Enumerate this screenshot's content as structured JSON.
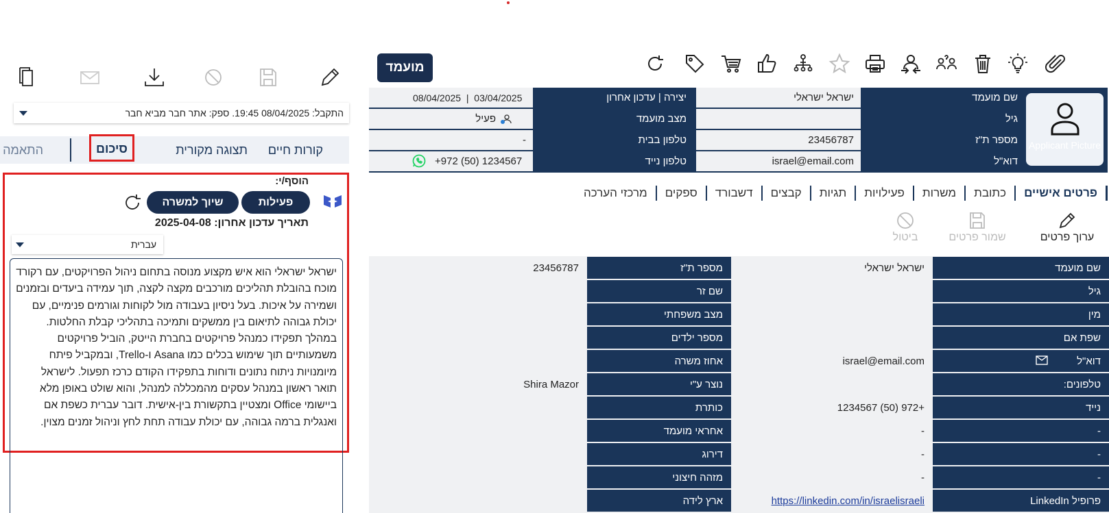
{
  "toolbar_right": {
    "brand_label": "מועמד",
    "icons": [
      "refresh-icon",
      "tag-icon",
      "cart-icon",
      "thumbs-up-icon",
      "org-chart-icon",
      "star-icon",
      "print-icon",
      "user-transfer-icon",
      "users-question-icon",
      "trash-icon",
      "lightbulb-icon",
      "paperclip-icon"
    ]
  },
  "header": {
    "avatar_text": "Applicant Picture",
    "rows": [
      {
        "label1": "שם מועמד",
        "value1": "ישראל ישראלי",
        "label2": "יצירה | עדכון אחרון",
        "value2a": "03/04/2025",
        "value2sep": "|",
        "value2b": "08/04/2025"
      },
      {
        "label1": "גיל",
        "value1": "",
        "label2": "מצב מועמד",
        "value2": "פעיל"
      },
      {
        "label1": "מספר ת\"ז",
        "value1": "23456787",
        "label2": "טלפון בבית",
        "value2": "-"
      },
      {
        "label1": "דוא\"ל",
        "value1": "israel@email.com",
        "label2": "טלפון נייד",
        "value2": "+972 (50) 1234567"
      }
    ]
  },
  "tabs": [
    "פרטים אישיים",
    "כתובת",
    "משרות",
    "פעילויות",
    "תגיות",
    "קבצים",
    "דשבורד",
    "ספקים",
    "מרכזי הערכה"
  ],
  "actions": {
    "edit": "ערוך פרטים",
    "save": "שמור פרטים",
    "cancel": "ביטול"
  },
  "details": [
    {
      "l1": "שם מועמד",
      "v1": "ישראל ישראלי",
      "l2": "מספר ת\"ז",
      "v2": "23456787"
    },
    {
      "l1": "גיל",
      "v1": "",
      "l2": "שם זר",
      "v2": ""
    },
    {
      "l1": "מין",
      "v1": "",
      "l2": "מצב משפחתי",
      "v2": ""
    },
    {
      "l1": "שפת אם",
      "v1": "",
      "l2": "מספר ילדים",
      "v2": ""
    },
    {
      "l1": "דוא\"ל",
      "v1": "israel@email.com",
      "l2": "אחוז משרה",
      "v2": ""
    },
    {
      "l1": "טלפונים:",
      "v1": "",
      "l2": "נוצר ע\"י",
      "v2": "Shira Mazor"
    },
    {
      "l1": "נייד",
      "v1": "+972 (50) 1234567",
      "l2": "כותרת",
      "v2": ""
    },
    {
      "l1": "-",
      "v1": "-",
      "l2": "אחראי מועמד",
      "v2": ""
    },
    {
      "l1": "-",
      "v1": "-",
      "l2": "דירוג",
      "v2": ""
    },
    {
      "l1": "-",
      "v1": "-",
      "l2": "מזהה חיצוני",
      "v2": ""
    },
    {
      "l1": "פרופיל LinkedIn",
      "v1": "https://linkedin.com/in/israelisraeli",
      "l2": "ארץ לידה",
      "v2": ""
    }
  ],
  "left": {
    "toolbar_icons": [
      "document-copy-icon",
      "mail-icon",
      "download-icon",
      "block-icon",
      "save-icon",
      "pencil-icon"
    ],
    "received": "התקבל: 08/04/2025 19:45. ספק: אתר חבר מביא חבר",
    "tabs": [
      "קורות חיים",
      "תצוגה מקורית",
      "סיכום",
      "התאמה"
    ],
    "added_by": "הוסף/י:",
    "btn_activities": "פעילות",
    "btn_assign": "שיוך למשרה",
    "last_update": "תאריך עדכון אחרון: 2025-04-08",
    "language": "עברית",
    "summary": "ישראל ישראלי הוא איש מקצוע מנוסה בתחום ניהול הפרויקטים, עם רקורד מוכח בהובלת תהליכים מורכבים מקצה לקצה, תוך עמידה ביעדים ובזמנים ושמירה על איכות. בעל ניסיון בעבודה מול לקוחות וגורמים פנימיים, עם יכולת גבוהה לתיאום בין ממשקים ותמיכה בתהליכי קבלת החלטות. במהלך תפקידו כמנהל פרויקטים בחברת הייטק, הוביל פרויקטים משמעותיים תוך שימוש בכלים כמו Asana ו-Trello, ובמקביל פיתח מיומנויות ניתוח נתונים ודוחות בתפקידו הקודם כרכז תפעול. לישראל תואר ראשון במנהל עסקים מהמכללה למנהל, והוא שולט באופן מלא ביישומי Office ומצטיין בתקשורת בין-אישית. דובר עברית כשפת אם ואנגלית ברמה גבוהה, עם יכולת עבודה תחת לחץ וניהול זמנים מצוין."
  },
  "colors": {
    "navy": "#1a3559",
    "red_highlight": "#e02020",
    "grid_bg": "#f0f1f3",
    "whatsapp": "#25d366"
  }
}
